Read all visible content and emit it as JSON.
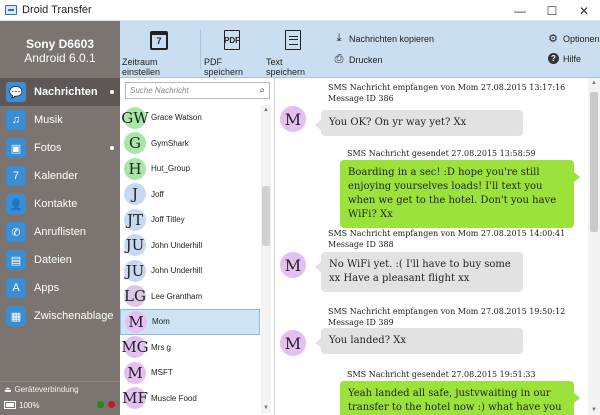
{
  "window": {
    "title": "Droid Transfer",
    "controls": [
      "—",
      "☐",
      "✕"
    ]
  },
  "device": {
    "name": "Sony D6603",
    "os": "Android 6.0.1"
  },
  "nav": {
    "items": [
      {
        "label": "Nachrichten",
        "icon": "chat-bubble-icon",
        "glyph": "💬",
        "active": true,
        "dot": true
      },
      {
        "label": "Musik",
        "icon": "music-note-icon",
        "glyph": "♫",
        "active": false,
        "dot": false
      },
      {
        "label": "Fotos",
        "icon": "photos-icon",
        "glyph": "▣",
        "active": false,
        "dot": true
      },
      {
        "label": "Kalender",
        "icon": "calendar-icon",
        "glyph": "7",
        "active": false,
        "dot": false
      },
      {
        "label": "Kontakte",
        "icon": "contacts-icon",
        "glyph": "👤",
        "active": false,
        "dot": false
      },
      {
        "label": "Anruflisten",
        "icon": "phone-icon",
        "glyph": "✆",
        "active": false,
        "dot": false
      },
      {
        "label": "Dateien",
        "icon": "files-icon",
        "glyph": "▤",
        "active": false,
        "dot": false
      },
      {
        "label": "Apps",
        "icon": "apps-icon",
        "glyph": "A",
        "active": false,
        "dot": false
      },
      {
        "label": "Zwischenablage",
        "icon": "clipboard-icon",
        "glyph": "▦",
        "active": false,
        "dot": false
      }
    ]
  },
  "footer": {
    "connection_label": "Geräteverbindung",
    "battery": "100%"
  },
  "toolbar": {
    "zeitraum": "Zeitraum einstellen",
    "calendar_glyph": "7",
    "pdf": "PDF speichern",
    "pdf_glyph": "PDF",
    "text": "Text speichern",
    "copy": "Nachrichten kopieren",
    "print": "Drucken",
    "options": "Optionen",
    "help": "Hilfe",
    "help_glyph": "?"
  },
  "search": {
    "placeholder": "Suche Nachricht"
  },
  "contacts": [
    {
      "initials": "GW",
      "name": "Grace Watson",
      "color": "#a8e6a8"
    },
    {
      "initials": "G",
      "name": "GymShark",
      "color": "#a8e6a8"
    },
    {
      "initials": "H",
      "name": "Hut_Group",
      "color": "#a8e6a8"
    },
    {
      "initials": "J",
      "name": "Joff",
      "color": "#c6d9f1"
    },
    {
      "initials": "JT",
      "name": "Joff Titley",
      "color": "#c6d9f1"
    },
    {
      "initials": "JU",
      "name": "John Underhill",
      "color": "#c6d9f1"
    },
    {
      "initials": "JU",
      "name": "John Underhill",
      "color": "#c6d9f1"
    },
    {
      "initials": "LG",
      "name": "Lee Grantham",
      "color": "#d9c8e6"
    },
    {
      "initials": "M",
      "name": "Mom",
      "color": "#e3bff2",
      "selected": true
    },
    {
      "initials": "MG",
      "name": "Mrs g",
      "color": "#e3bff2"
    },
    {
      "initials": "M",
      "name": "MSFT",
      "color": "#e3bff2"
    },
    {
      "initials": "MF",
      "name": "Muscle Food",
      "color": "#e3bff2"
    }
  ],
  "messages": [
    {
      "direction": "in",
      "header": "SMS Nachricht empfangen von Mom 27.08.2015 13:17:16 Message ID 386",
      "avatar": "M",
      "text": "You OK? On yr way yet? Xx"
    },
    {
      "direction": "out",
      "header": "SMS Nachricht gesendet 27.08.2015 13:58:59",
      "text": "Boarding in a sec! :D hope you're still enjoying yourselves loads! I'll text you when we get to the hotel. Don't you have WiFi? Xx"
    },
    {
      "direction": "in",
      "header": "SMS Nachricht empfangen von Mom 27.08.2015 14:00:41 Message ID 388",
      "avatar": "M",
      "text": "No WiFi yet. :( I'll have to buy some xx Have a pleasant flight xx"
    },
    {
      "direction": "in",
      "header": "SMS Nachricht empfangen von Mom 27.08.2015 19:50:12 Message ID 389",
      "avatar": "M",
      "text": "You landed? Xx"
    },
    {
      "direction": "out",
      "header": "SMS Nachricht gesendet 27.08.2015 19:51:33",
      "text": "Yeah landed all safe, justvwaiting in our transfer to the hotel now :) what have you guys"
    }
  ],
  "colors": {
    "sidebar_bg": "#7b7470",
    "sidebar_active": "#5e5755",
    "toolbar_bg": "#c9def0",
    "nav_icon": "#3a8fd4",
    "incoming_bubble": "#e2e2e2",
    "outgoing_bubble": "#9be23b",
    "mom_avatar": "#e3bff2"
  }
}
